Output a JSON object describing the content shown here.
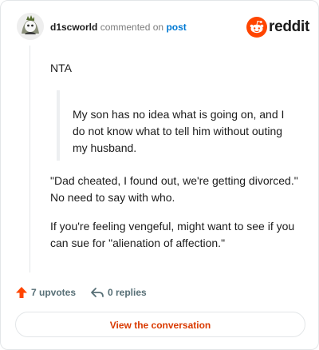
{
  "comment": {
    "author": "d1scworld",
    "action_text": "commented on",
    "post_link_text": "post",
    "paragraphs": [
      "NTA",
      "\"Dad cheated, I found out, we're getting divorced.\" No need to say with who.",
      "If you're feeling vengeful, might want to see if you can sue for \"alienation of affection.\""
    ],
    "quote": "My son has no idea what is going on, and I do not know what to tell him without outing my husband."
  },
  "brand": {
    "name": "reddit",
    "logo_icon": "reddit-logo-icon",
    "accent_color": "#ff4500"
  },
  "footer": {
    "upvotes_label": "7 upvotes",
    "replies_label": "0 replies",
    "upvote_color": "#ff4500"
  },
  "cta": {
    "label": "View the conversation",
    "color": "#d93900"
  },
  "avatar": {
    "icon": "avatar-icon"
  }
}
